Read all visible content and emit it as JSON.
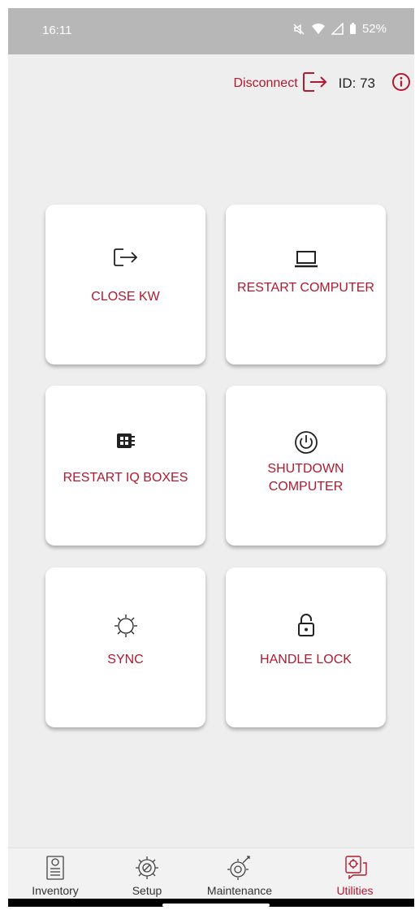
{
  "status_bar": {
    "time": "16:11",
    "battery": "52%",
    "icons": [
      "mute-icon",
      "wifi-icon",
      "signal-icon",
      "battery-icon"
    ]
  },
  "header": {
    "disconnect_label": "Disconnect",
    "disconnect_icon": "logout-icon",
    "id_label": "ID: 73",
    "info_icon": "info-icon"
  },
  "actions": [
    {
      "label": "CLOSE KW",
      "icon": "logout-icon"
    },
    {
      "label": "RESTART COMPUTER",
      "icon": "laptop-icon"
    },
    {
      "label": "RESTART IQ BOXES",
      "icon": "iq-box-icon"
    },
    {
      "label": "SHUTDOWN COMPUTER",
      "icon": "power-icon"
    },
    {
      "label": "SYNC",
      "icon": "gear-icon"
    },
    {
      "label": "HANDLE LOCK",
      "icon": "unlock-icon"
    }
  ],
  "nav": [
    {
      "label": "Inventory",
      "icon": "inventory-icon",
      "active": false
    },
    {
      "label": "Setup",
      "icon": "setup-icon",
      "active": false
    },
    {
      "label": "Maintenance",
      "icon": "maintenance-icon",
      "active": false
    },
    {
      "label": "Utilities",
      "icon": "utilities-icon",
      "active": true
    }
  ],
  "colors": {
    "accent": "#b0192f",
    "background": "#eeeeee",
    "status_bar": "#b7b7b7",
    "card": "#ffffff"
  }
}
